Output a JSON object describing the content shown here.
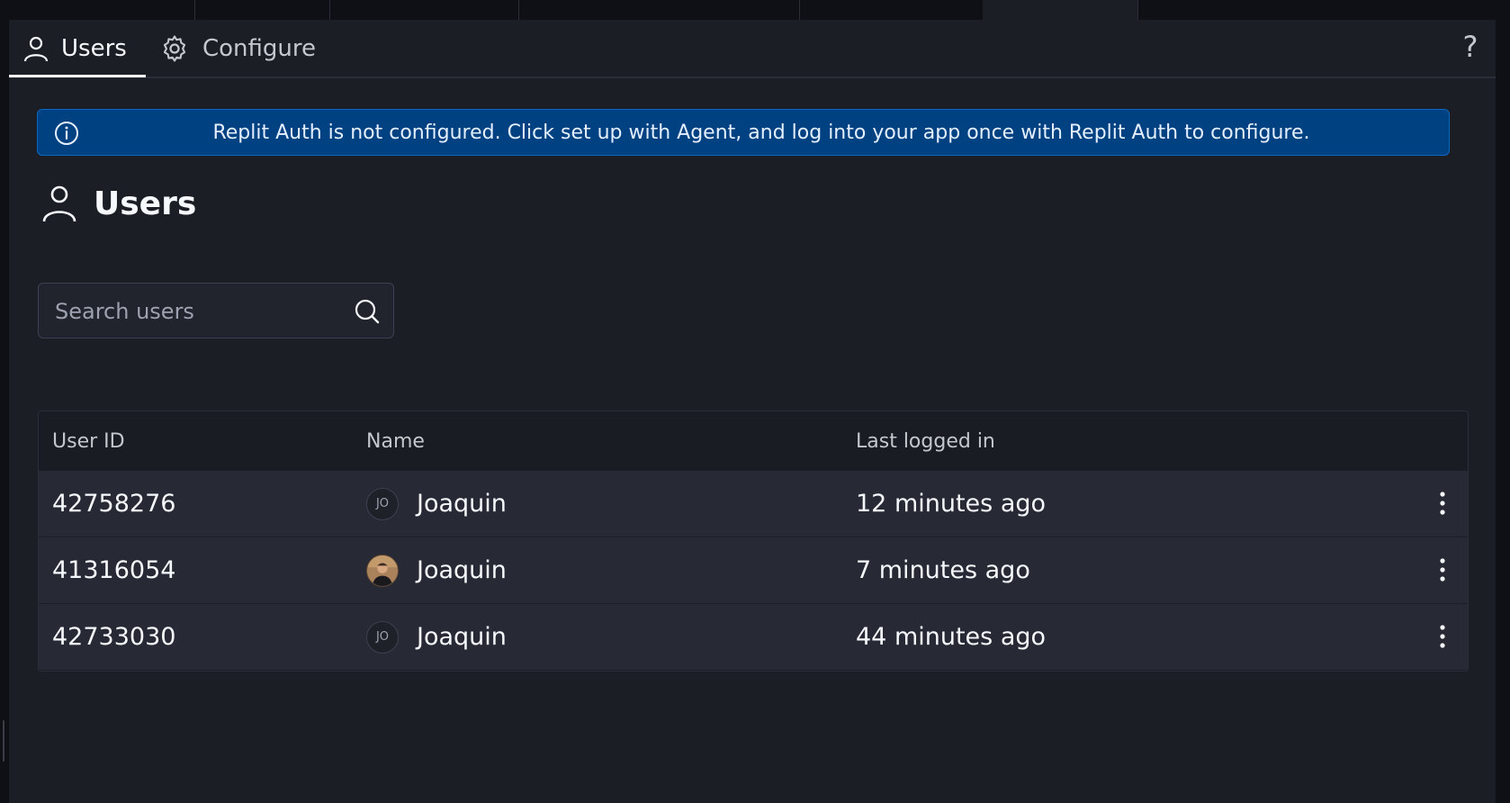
{
  "tabs": [
    {
      "label": "Users",
      "icon": "user-icon",
      "active": true
    },
    {
      "label": "Configure",
      "icon": "gear-icon",
      "active": false
    }
  ],
  "help_label": "?",
  "banner": {
    "text": "Replit Auth is not configured. Click set up with Agent, and log into your app once with Replit Auth to configure.",
    "icon": "info-icon",
    "color": "#004182"
  },
  "page": {
    "title": "Users",
    "icon": "user-icon"
  },
  "search": {
    "placeholder": "Search users",
    "value": ""
  },
  "table": {
    "columns": [
      "User ID",
      "Name",
      "Last logged in"
    ],
    "rows": [
      {
        "user_id": "42758276",
        "avatar_initials": "JO",
        "avatar_type": "initials",
        "name": "Joaquin",
        "last_logged_in": "12 minutes ago"
      },
      {
        "user_id": "41316054",
        "avatar_initials": "",
        "avatar_type": "photo",
        "name": "Joaquin",
        "last_logged_in": "7 minutes ago"
      },
      {
        "user_id": "42733030",
        "avatar_initials": "JO",
        "avatar_type": "initials",
        "name": "Joaquin",
        "last_logged_in": "44 minutes ago"
      }
    ]
  },
  "colors": {
    "background": "#1c1e26",
    "banner_bg": "#004182",
    "banner_border": "#0a67c2",
    "text": "#f5f9fc",
    "muted_text": "#c2c8cc"
  }
}
